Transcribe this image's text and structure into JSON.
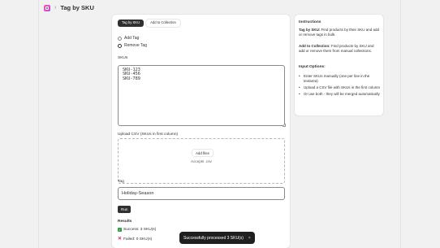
{
  "header": {
    "title": "Tag by SKU",
    "icon": "app-icon"
  },
  "tabs": [
    {
      "label": "Tag by SKU",
      "active": true
    },
    {
      "label": "Add to Collection",
      "active": false
    }
  ],
  "mode_options": [
    {
      "label": "Add Tag",
      "checked": false
    },
    {
      "label": "Remove Tag",
      "checked": true
    }
  ],
  "skus": {
    "label": "SKUs",
    "value": "SKU-123\nSKU-456\nSKU-789"
  },
  "upload": {
    "label": "Upload CSV (SKUs in first column)",
    "button": "Add files",
    "accept": "Accepts .csv"
  },
  "tag": {
    "label": "Tag",
    "value": "Holiday-Season"
  },
  "run_label": "Run",
  "results": {
    "title": "Results",
    "success": "Success: 3 SKU(s)",
    "failed": "Failed: 0 SKU(s)"
  },
  "instructions": {
    "title": "Instructions",
    "tag_by_sku_bold": "Tag by SKU:",
    "tag_by_sku_text": " Find products by their SKU and add or remove tags in bulk.",
    "add_to_collection_bold": "Add to Collection:",
    "add_to_collection_text": " Find products by SKU and add or remove them from manual collections.",
    "input_options_title": "Input Options:",
    "options": [
      "Enter SKUs manually (one per line in the textarea)",
      "Upload a CSV file with SKUs in the first column",
      "Or use both - they will be merged automatically"
    ]
  },
  "toast": {
    "message": "Successfully processed 3 SKU(s)",
    "close": "×"
  },
  "colors": {
    "primary": "#303030",
    "success": "#2e9e44",
    "error": "#d7263d",
    "background": "#f1f1f1"
  }
}
